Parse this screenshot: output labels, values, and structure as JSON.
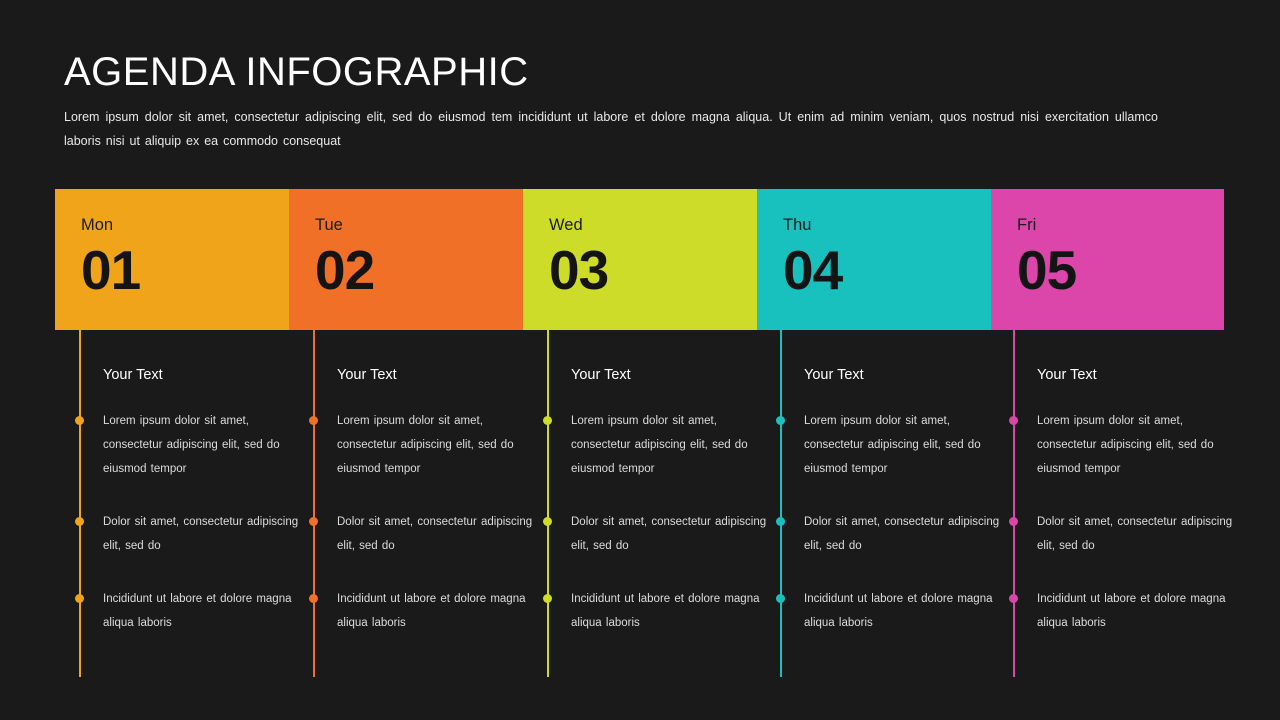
{
  "header": {
    "title": "AGENDA INFOGRAPHIC",
    "subtitle": "Lorem ipsum dolor sit amet, consectetur adipiscing elit, sed do eiusmod tem incididunt ut labore et dolore magna aliqua. Ut enim ad minim veniam, quos nostrud nisi exercitation ullamco laboris nisi ut aliquip ex ea commodo consequat"
  },
  "theme": {
    "background": "#1a1a1a",
    "title_color": "#ffffff",
    "body_text_color": "#dcdcdc",
    "card_text_color": "#141414"
  },
  "days": [
    {
      "name": "Mon",
      "number": "01",
      "color": "#f0a41a",
      "heading": "Your Text",
      "bullets": [
        "Lorem ipsum dolor sit amet, consectetur adipiscing elit, sed do eiusmod tempor",
        "Dolor sit amet, consectetur adipiscing elit, sed do",
        "Incididunt ut labore et dolore magna aliqua laboris"
      ]
    },
    {
      "name": "Tue",
      "number": "02",
      "color": "#f07028",
      "heading": "Your Text",
      "bullets": [
        "Lorem ipsum dolor sit amet, consectetur adipiscing elit, sed do eiusmod tempor",
        "Dolor sit amet, consectetur adipiscing elit, sed do",
        "Incididunt ut labore et dolore magna aliqua laboris"
      ]
    },
    {
      "name": "Wed",
      "number": "03",
      "color": "#ccdc28",
      "heading": "Your Text",
      "bullets": [
        "Lorem ipsum dolor sit amet, consectetur adipiscing elit, sed do eiusmod tempor",
        "Dolor sit amet, consectetur adipiscing elit, sed do",
        "Incididunt ut labore et dolore magna aliqua laboris"
      ]
    },
    {
      "name": "Thu",
      "number": "04",
      "color": "#18c0be",
      "heading": "Your Text",
      "bullets": [
        "Lorem ipsum dolor sit amet, consectetur adipiscing elit, sed do eiusmod tempor",
        "Dolor sit amet, consectetur adipiscing elit, sed do",
        "Incididunt ut labore et dolore magna aliqua laboris"
      ]
    },
    {
      "name": "Fri",
      "number": "05",
      "color": "#dc45aa",
      "heading": "Your Text",
      "bullets": [
        "Lorem ipsum dolor sit amet, consectetur adipiscing elit, sed do eiusmod tempor",
        "Dolor sit amet, consectetur adipiscing elit, sed do",
        "Incididunt ut labore et dolore magna aliqua laboris"
      ]
    }
  ]
}
